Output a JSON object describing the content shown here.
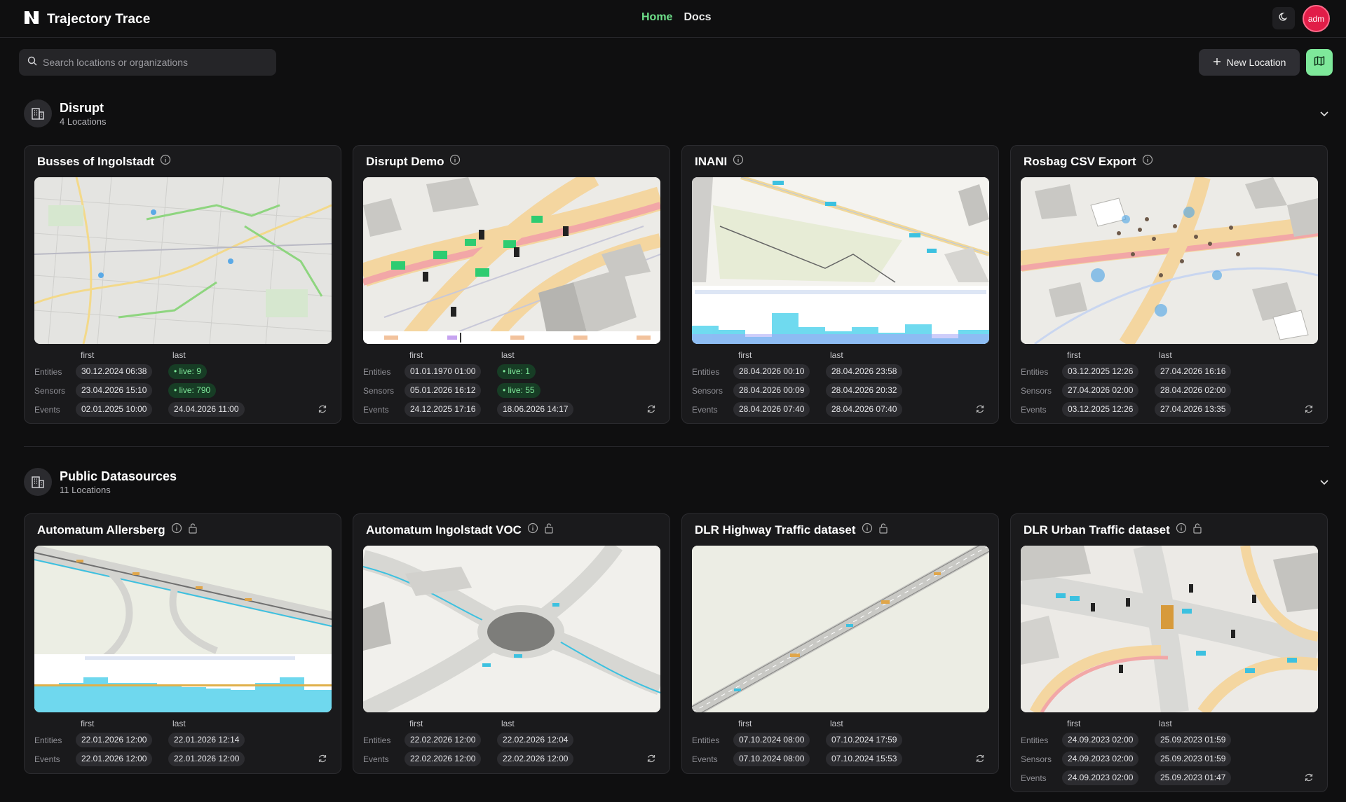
{
  "app": {
    "title": "Trajectory Trace"
  },
  "nav": {
    "home": "Home",
    "docs": "Docs"
  },
  "user": {
    "avatar": "adm"
  },
  "search": {
    "placeholder": "Search locations or organizations"
  },
  "toolbar": {
    "new_location": "New Location"
  },
  "meta_headers": {
    "first": "first",
    "last": "last"
  },
  "labels": {
    "entities": "Entities",
    "sensors": "Sensors",
    "events": "Events"
  },
  "groups": [
    {
      "title": "Disrupt",
      "subtitle": "4 Locations",
      "cards": [
        {
          "title": "Busses of Ingolstadt",
          "entities": {
            "first": "30.12.2024 06:38",
            "last": "live: 9"
          },
          "sensors": {
            "first": "23.04.2026 15:10",
            "last": "live: 790"
          },
          "events": {
            "first": "02.01.2025 10:00",
            "last": "24.04.2026 11:00"
          }
        },
        {
          "title": "Disrupt Demo",
          "entities": {
            "first": "01.01.1970 01:00",
            "last": "live: 1"
          },
          "sensors": {
            "first": "05.01.2026 16:12",
            "last": "live: 55"
          },
          "events": {
            "first": "24.12.2025 17:16",
            "last": "18.06.2026 14:17"
          }
        },
        {
          "title": "INANI",
          "entities": {
            "first": "28.04.2026 00:10",
            "last": "28.04.2026 23:58"
          },
          "sensors": {
            "first": "28.04.2026 00:09",
            "last": "28.04.2026 20:32"
          },
          "events": {
            "first": "28.04.2026 07:40",
            "last": "28.04.2026 07:40"
          }
        },
        {
          "title": "Rosbag CSV Export",
          "entities": {
            "first": "03.12.2025 12:26",
            "last": "27.04.2026 16:16"
          },
          "sensors": {
            "first": "27.04.2026 02:00",
            "last": "28.04.2026 02:00"
          },
          "events": {
            "first": "03.12.2025 12:26",
            "last": "27.04.2026 13:35"
          }
        }
      ]
    },
    {
      "title": "Public Datasources",
      "subtitle": "11 Locations",
      "cards": [
        {
          "title": "Automatum Allersberg",
          "entities": {
            "first": "22.01.2026 12:00",
            "last": "22.01.2026 12:14"
          },
          "events": {
            "first": "22.01.2026 12:00",
            "last": "22.01.2026 12:00"
          }
        },
        {
          "title": "Automatum Ingolstadt VOC",
          "entities": {
            "first": "22.02.2026 12:00",
            "last": "22.02.2026 12:04"
          },
          "events": {
            "first": "22.02.2026 12:00",
            "last": "22.02.2026 12:00"
          }
        },
        {
          "title": "DLR Highway Traffic dataset",
          "entities": {
            "first": "07.10.2024 08:00",
            "last": "07.10.2024 17:59"
          },
          "events": {
            "first": "07.10.2024 08:00",
            "last": "07.10.2024 15:53"
          }
        },
        {
          "title": "DLR Urban Traffic dataset",
          "entities": {
            "first": "24.09.2023 02:00",
            "last": "25.09.2023 01:59"
          },
          "sensors": {
            "first": "24.09.2023 02:00",
            "last": "25.09.2023 01:59"
          },
          "events": {
            "first": "24.09.2023 02:00",
            "last": "25.09.2023 01:47"
          }
        }
      ]
    }
  ],
  "colors": {
    "accent": "#6ee08a",
    "avatar": "#e11d48",
    "card_bg": "#1a1a1c",
    "live_pill": "#173d25"
  },
  "icons": {
    "logo": "n-logo-icon",
    "theme": "moon-icon",
    "search": "search-icon",
    "new": "plus-icon",
    "map": "map-icon",
    "group": "building-icon",
    "collapse": "chevron-down-icon",
    "info": "info-icon",
    "lock": "lock-icon",
    "refresh": "refresh-icon"
  }
}
